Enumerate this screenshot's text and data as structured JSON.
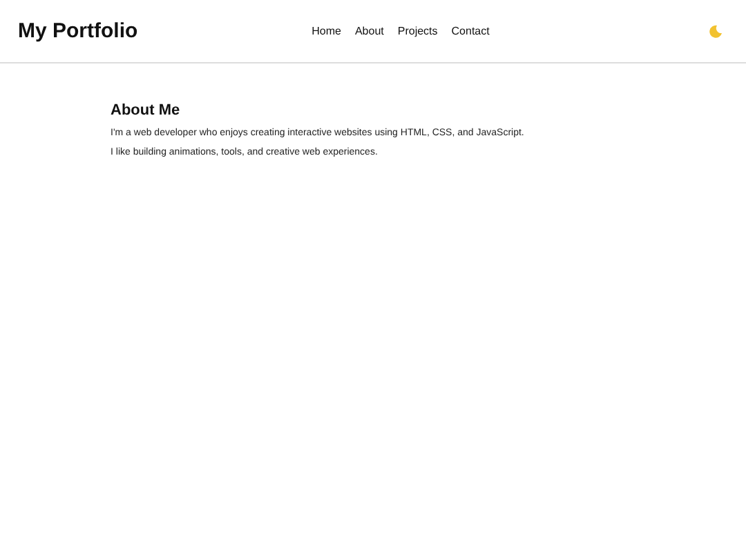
{
  "header": {
    "title": "My Portfolio",
    "nav": [
      "Home",
      "About",
      "Projects",
      "Contact"
    ]
  },
  "section": {
    "heading": "About Me",
    "paragraphs": [
      "I'm a web developer who enjoys creating interactive websites using HTML, CSS, and JavaScript.",
      "I like building animations, tools, and creative web experiences."
    ]
  }
}
